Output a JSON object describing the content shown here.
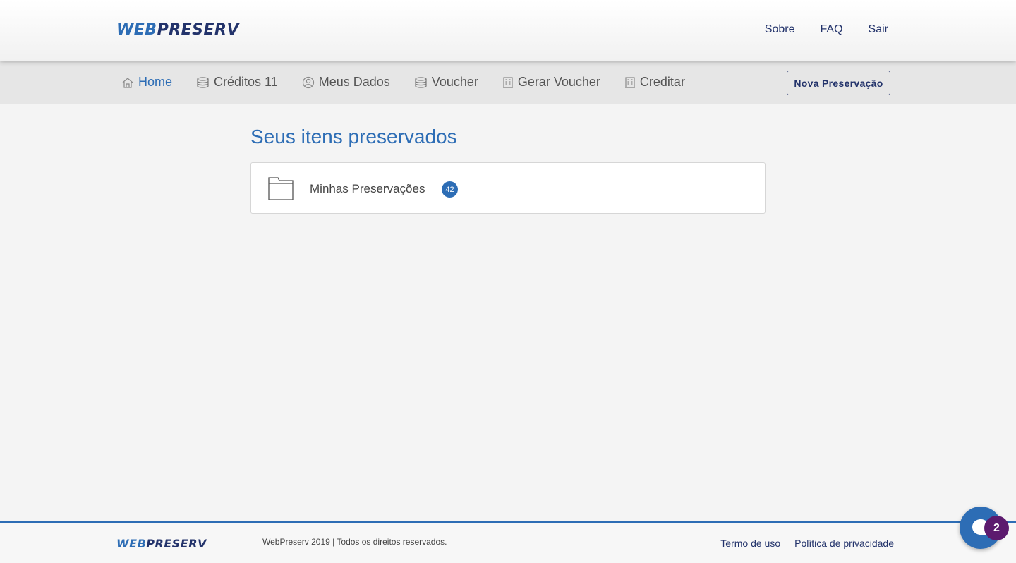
{
  "header": {
    "logo_web": "WEB",
    "logo_preserv": "PRESERV",
    "links": [
      "Sobre",
      "FAQ",
      "Sair"
    ]
  },
  "subnav": {
    "items": [
      {
        "label": "Home",
        "icon": "home-icon",
        "active": true
      },
      {
        "label": "Créditos 11",
        "icon": "coins-icon",
        "active": false
      },
      {
        "label": "Meus Dados",
        "icon": "user-icon",
        "active": false
      },
      {
        "label": "Voucher",
        "icon": "coins-icon",
        "active": false
      },
      {
        "label": "Gerar Voucher",
        "icon": "building-icon",
        "active": false
      },
      {
        "label": "Creditar",
        "icon": "building-icon",
        "active": false
      }
    ],
    "nova_button": "Nova Preservação"
  },
  "main": {
    "title": "Seus itens preservados",
    "folder": {
      "label": "Minhas Preservações",
      "count": "42",
      "icon": "folder-icon"
    }
  },
  "footer": {
    "logo_web": "WEB",
    "logo_preserv": "PRESERV",
    "copyright": "WebPreserv 2019 | Todos os direitos reservados.",
    "links": [
      "Termo de uso",
      "Política de privacidade"
    ]
  },
  "chat": {
    "unread": "2",
    "icon": "chat-icon"
  },
  "colors": {
    "primary": "#2d6db5",
    "navy": "#23336b",
    "badge_purple": "#5c1a6e"
  }
}
